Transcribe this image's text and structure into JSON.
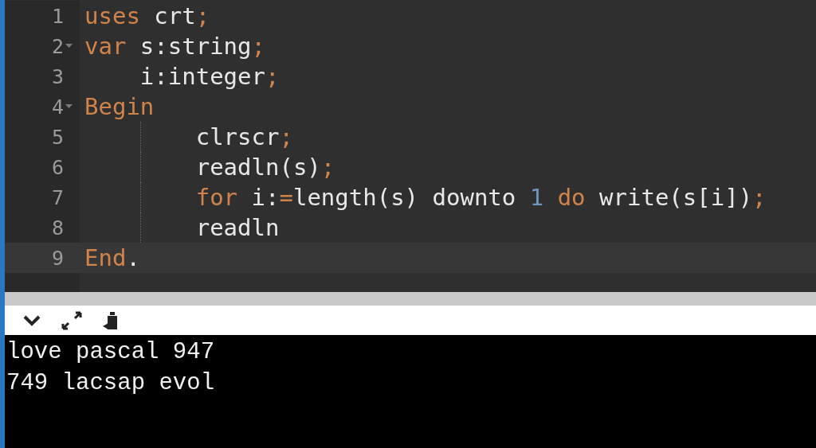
{
  "editor": {
    "lines": [
      {
        "number": "1",
        "foldable": false,
        "current": false,
        "indent_guide": false,
        "tokens": [
          {
            "kind": "keyword",
            "text": "uses"
          },
          {
            "kind": "plain",
            "text": " crt"
          },
          {
            "kind": "punct",
            "text": ";"
          }
        ]
      },
      {
        "number": "2",
        "foldable": true,
        "current": false,
        "indent_guide": false,
        "tokens": [
          {
            "kind": "keyword",
            "text": "var"
          },
          {
            "kind": "plain",
            "text": " s:string"
          },
          {
            "kind": "punct",
            "text": ";"
          }
        ]
      },
      {
        "number": "3",
        "foldable": false,
        "current": false,
        "indent_guide": false,
        "tokens": [
          {
            "kind": "plain",
            "text": "    i:integer"
          },
          {
            "kind": "punct",
            "text": ";"
          }
        ]
      },
      {
        "number": "4",
        "foldable": true,
        "current": false,
        "indent_guide": false,
        "tokens": [
          {
            "kind": "keyword",
            "text": "Begin"
          }
        ]
      },
      {
        "number": "5",
        "foldable": false,
        "current": false,
        "indent_guide": true,
        "tokens": [
          {
            "kind": "plain",
            "text": "        clrscr"
          },
          {
            "kind": "punct",
            "text": ";"
          }
        ]
      },
      {
        "number": "6",
        "foldable": false,
        "current": false,
        "indent_guide": true,
        "tokens": [
          {
            "kind": "plain",
            "text": "        readln(s)"
          },
          {
            "kind": "punct",
            "text": ";"
          }
        ]
      },
      {
        "number": "7",
        "foldable": false,
        "current": false,
        "indent_guide": true,
        "tokens": [
          {
            "kind": "keyword",
            "text": "        for"
          },
          {
            "kind": "plain",
            "text": " i:"
          },
          {
            "kind": "punct",
            "text": "="
          },
          {
            "kind": "plain",
            "text": "length(s) downto "
          },
          {
            "kind": "number",
            "text": "1"
          },
          {
            "kind": "keyword",
            "text": " do"
          },
          {
            "kind": "plain",
            "text": " write(s[i])"
          },
          {
            "kind": "punct",
            "text": ";"
          }
        ]
      },
      {
        "number": "8",
        "foldable": false,
        "current": false,
        "indent_guide": true,
        "tokens": [
          {
            "kind": "plain",
            "text": "        readln"
          }
        ]
      },
      {
        "number": "9",
        "foldable": false,
        "current": true,
        "indent_guide": false,
        "tokens": [
          {
            "kind": "keyword",
            "text": "End"
          },
          {
            "kind": "plain",
            "text": "."
          }
        ]
      }
    ]
  },
  "console": {
    "output": [
      "love pascal 947",
      "749 lacsap evol"
    ]
  }
}
